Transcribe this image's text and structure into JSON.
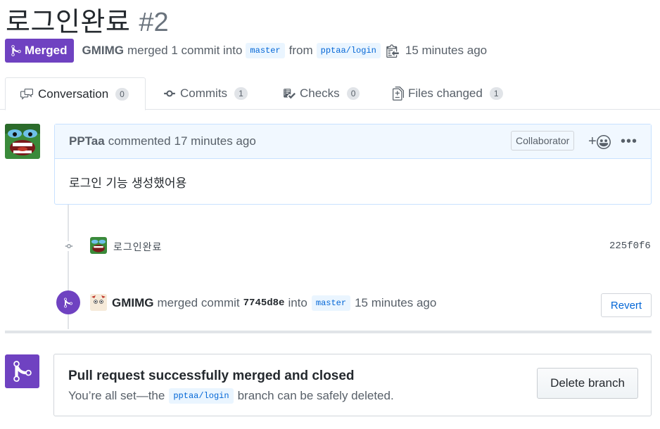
{
  "pr": {
    "title": "로그인완료",
    "number": "#2",
    "state_label": "Merged",
    "author": "GMIMG",
    "merge_text": "merged 1 commit into",
    "base_branch": "master",
    "from_text": "from",
    "head_branch": "pptaa/login",
    "time": "15 minutes ago"
  },
  "tabs": [
    {
      "label": "Conversation",
      "count": "0",
      "icon": "comment-discussion-icon"
    },
    {
      "label": "Commits",
      "count": "1",
      "icon": "git-commit-icon"
    },
    {
      "label": "Checks",
      "count": "0",
      "icon": "checklist-icon"
    },
    {
      "label": "Files changed",
      "count": "1",
      "icon": "file-diff-icon"
    }
  ],
  "comment": {
    "author": "PPTaa",
    "action": "commented",
    "time": "17 minutes ago",
    "role": "Collaborator",
    "body": "로그인 기능 생성했어용"
  },
  "commit": {
    "message": "로그인완료",
    "sha": "225f0f6"
  },
  "merge_event": {
    "author": "GMIMG",
    "text": "merged commit",
    "sha": "7745d8e",
    "into": "into",
    "branch": "master",
    "time": "15 minutes ago",
    "revert_label": "Revert"
  },
  "merged_box": {
    "heading": "Pull request successfully merged and closed",
    "desc_before": "You’re all set—the",
    "branch": "pptaa/login",
    "desc_after": "branch can be safely deleted.",
    "delete_label": "Delete branch"
  },
  "colors": {
    "merged_purple": "#6f42c1",
    "link_blue": "#0366d6",
    "comment_header_bg": "#f1f8ff"
  }
}
